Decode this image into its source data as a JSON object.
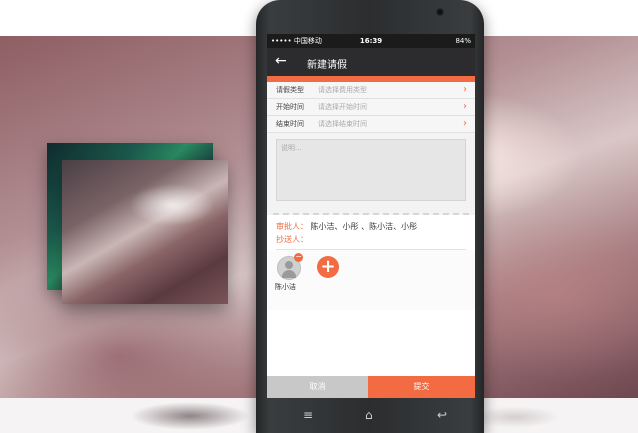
{
  "status": {
    "carrier": "••••• 中国移动",
    "time": "16:39",
    "battery": "84%"
  },
  "header": {
    "title": "新建请假"
  },
  "form": {
    "rows": [
      {
        "label": "请假类型",
        "placeholder": "请选择费用类型"
      },
      {
        "label": "开始时间",
        "placeholder": "请选择开始时间"
      },
      {
        "label": "结束时间",
        "placeholder": "请选择结束时间"
      }
    ],
    "note_placeholder": "说明..."
  },
  "approvers": {
    "label": "审批人：",
    "names": "陈小洁、小彤  、陈小洁、小彤"
  },
  "cc": {
    "label": "抄送人："
  },
  "cc_people": [
    {
      "name": "陈小洁"
    }
  ],
  "buttons": {
    "cancel": "取消",
    "submit": "提交"
  },
  "colors": {
    "accent": "#f26b43",
    "header_bg": "#2c2c2e",
    "cancel_bg": "#c8c8c8"
  }
}
